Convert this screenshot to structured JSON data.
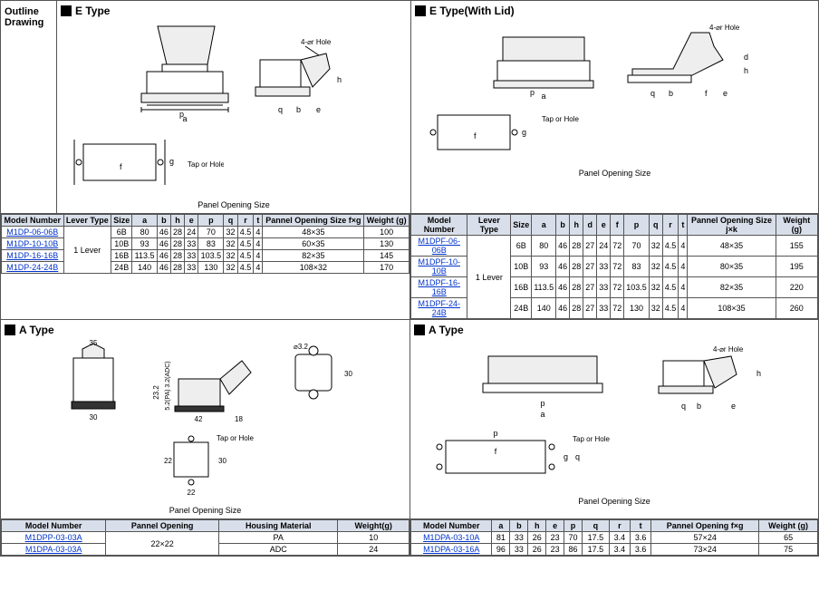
{
  "sidebar": {
    "title1": "Outline",
    "title2": "Drawing"
  },
  "sections": {
    "etype": {
      "label": "E Type",
      "hole_label": "4-⌀r Hole",
      "panel_label": "Panel Opening Size",
      "tap_label": "Tap or Hole"
    },
    "etype_lid": {
      "label": "E Type(With Lid)",
      "hole_label": "4-⌀r Hole",
      "panel_label": "Panel Opening Size",
      "tap_label": "Tap or Hole"
    },
    "atype_left": {
      "label": "A Type",
      "panel_label": "Panel Opening Size",
      "tap_label": "Tap or Hole"
    },
    "atype_right": {
      "label": "A Type",
      "hole_label": "4-⌀r Hole",
      "panel_label": "Panel Opening Size",
      "tap_label": "Tap or Hole"
    }
  },
  "table_etype": {
    "headers": [
      "Model Number",
      "Lever Type",
      "Size",
      "a",
      "b",
      "h",
      "e",
      "p",
      "q",
      "r",
      "t",
      "Pannel Opening Size f×g",
      "Weight (g)"
    ],
    "lever": "1 Lever",
    "rows": [
      {
        "model": "M1DP-06-06B",
        "size": "6B",
        "a": "80",
        "b": "46",
        "h": "28",
        "e": "24",
        "p": "70",
        "q": "32",
        "r": "4.5",
        "t": "4",
        "panel": "48×35",
        "w": "100"
      },
      {
        "model": "M1DP-10-10B",
        "size": "10B",
        "a": "93",
        "b": "46",
        "h": "28",
        "e": "33",
        "p": "83",
        "q": "32",
        "r": "4.5",
        "t": "4",
        "panel": "60×35",
        "w": "130"
      },
      {
        "model": "M1DP-16-16B",
        "size": "16B",
        "a": "113.5",
        "b": "46",
        "h": "28",
        "e": "33",
        "p": "103.5",
        "q": "32",
        "r": "4.5",
        "t": "4",
        "panel": "82×35",
        "w": "145"
      },
      {
        "model": "M1DP-24-24B",
        "size": "24B",
        "a": "140",
        "b": "46",
        "h": "28",
        "e": "33",
        "p": "130",
        "q": "32",
        "r": "4.5",
        "t": "4",
        "panel": "108×32",
        "w": "170"
      }
    ]
  },
  "table_etype_lid": {
    "headers": [
      "Model Number",
      "Lever Type",
      "Size",
      "a",
      "b",
      "h",
      "d",
      "e",
      "f",
      "p",
      "q",
      "r",
      "t",
      "Pannel Opening Size j×k",
      "Weight (g)"
    ],
    "lever": "1 Lever",
    "rows": [
      {
        "model": "M1DPF-06-06B",
        "size": "6B",
        "a": "80",
        "b": "46",
        "h": "28",
        "d": "27",
        "e": "24",
        "f": "72",
        "p": "70",
        "q": "32",
        "r": "4.5",
        "t": "4",
        "panel": "48×35",
        "w": "155"
      },
      {
        "model": "M1DPF-10-10B",
        "size": "10B",
        "a": "93",
        "b": "46",
        "h": "28",
        "d": "27",
        "e": "33",
        "f": "72",
        "p": "83",
        "q": "32",
        "r": "4.5",
        "t": "4",
        "panel": "80×35",
        "w": "195"
      },
      {
        "model": "M1DPF-16-16B",
        "size": "16B",
        "a": "113.5",
        "b": "46",
        "h": "28",
        "d": "27",
        "e": "33",
        "f": "72",
        "p": "103.5",
        "q": "32",
        "r": "4.5",
        "t": "4",
        "panel": "82×35",
        "w": "220"
      },
      {
        "model": "M1DPF-24-24B",
        "size": "24B",
        "a": "140",
        "b": "46",
        "h": "28",
        "d": "27",
        "e": "33",
        "f": "72",
        "p": "130",
        "q": "32",
        "r": "4.5",
        "t": "4",
        "panel": "108×35",
        "w": "260"
      }
    ]
  },
  "table_atype_left": {
    "headers": [
      "Model Number",
      "Pannel Opening",
      "Housing Material",
      "Weight(g)"
    ],
    "rows": [
      {
        "model": "M1DPP-03-03A",
        "panel": "22×22",
        "mat": "PA",
        "w": "10"
      },
      {
        "model": "M1DPA-03-03A",
        "panel": "22×22",
        "mat": "ADC",
        "w": "24"
      }
    ]
  },
  "table_atype_right": {
    "headers": [
      "Model Number",
      "a",
      "b",
      "h",
      "e",
      "p",
      "q",
      "r",
      "t",
      "Pannel Opening f×g",
      "Weight (g)"
    ],
    "rows": [
      {
        "model": "M1DPA-03-10A",
        "a": "81",
        "b": "33",
        "h": "26",
        "e": "23",
        "p": "70",
        "q": "17.5",
        "r": "3.4",
        "t": "3.6",
        "panel": "57×24",
        "w": "65"
      },
      {
        "model": "M1DPA-03-16A",
        "a": "96",
        "b": "33",
        "h": "26",
        "e": "23",
        "p": "86",
        "q": "17.5",
        "r": "3.4",
        "t": "3.6",
        "panel": "73×24",
        "w": "75"
      }
    ]
  },
  "dim_labels": {
    "a_left": {
      "w35": "35",
      "w30": "30",
      "h23": "23.2",
      "v5p": "5.2(PA)",
      "v3a": "3.2(ADC)",
      "w42": "42",
      "n18": "18",
      "d32": "⌀3.2",
      "h30": "30",
      "w22": "22",
      "g30": "30",
      "f22": "22"
    }
  }
}
